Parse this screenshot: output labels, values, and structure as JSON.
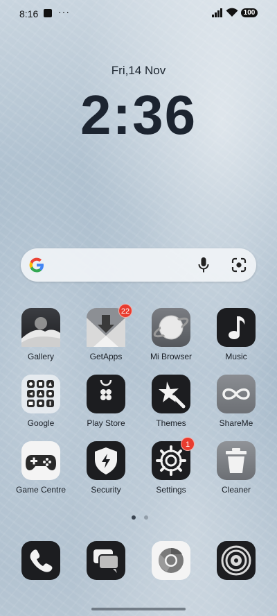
{
  "status": {
    "time": "8:16",
    "battery": "100"
  },
  "lock": {
    "date": "Fri,14 Nov",
    "clock": "2:36"
  },
  "apps": [
    {
      "label": "Gallery",
      "icon": "gallery-icon"
    },
    {
      "label": "GetApps",
      "icon": "getapps-icon",
      "badge": "22"
    },
    {
      "label": "Mi Browser",
      "icon": "mi-browser-icon"
    },
    {
      "label": "Music",
      "icon": "music-icon"
    },
    {
      "label": "Google",
      "icon": "google-folder-icon"
    },
    {
      "label": "Play Store",
      "icon": "play-store-icon"
    },
    {
      "label": "Themes",
      "icon": "themes-icon"
    },
    {
      "label": "ShareMe",
      "icon": "shareme-icon"
    },
    {
      "label": "Game Centre",
      "icon": "game-centre-icon"
    },
    {
      "label": "Security",
      "icon": "security-icon"
    },
    {
      "label": "Settings",
      "icon": "settings-icon",
      "badge": "1"
    },
    {
      "label": "Cleaner",
      "icon": "cleaner-icon"
    }
  ],
  "dock": [
    {
      "icon": "phone-icon"
    },
    {
      "icon": "messages-icon"
    },
    {
      "icon": "chrome-icon"
    },
    {
      "icon": "camera-icon"
    }
  ],
  "pager": {
    "pages": 2,
    "current": 1
  }
}
